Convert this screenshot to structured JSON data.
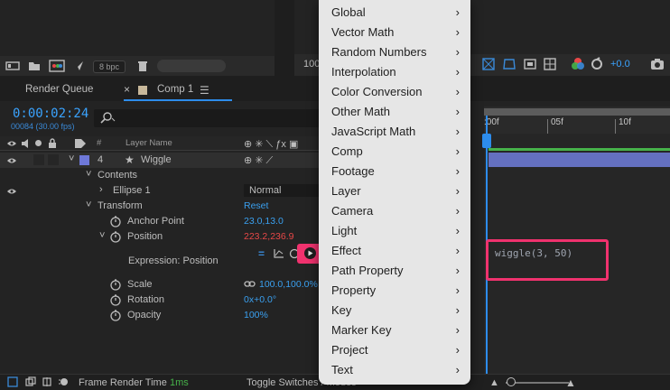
{
  "project_panel": {
    "bpc_label": "8 bpc"
  },
  "viewer_toolbar": {
    "zoom_value": "100",
    "exposure_value": "+0.0"
  },
  "tabs": [
    {
      "label": "Render Queue"
    },
    {
      "label": "Comp 1"
    }
  ],
  "timeline": {
    "current_time": "0:00:02:24",
    "frame_info": "00084 (30.00 fps)",
    "columns": {
      "number": "#",
      "layer_name": "Layer Name"
    },
    "ruler_labels": [
      ":00f",
      "05f",
      "10f"
    ],
    "rows": {
      "layer_number": "4",
      "layer_name": "Wiggle",
      "contents": "Contents",
      "ellipse": "Ellipse 1",
      "blend_mode": "Normal",
      "transform": "Transform",
      "reset": "Reset",
      "anchor_label": "Anchor Point",
      "anchor_value": "23.0,13.0",
      "position_label": "Position",
      "position_value": "223.2,236.9",
      "expression_label": "Expression: Position",
      "scale_label": "Scale",
      "scale_value": "100.0,100.0%",
      "rotation_label": "Rotation",
      "rotation_value": "0x+0.0°",
      "opacity_label": "Opacity",
      "opacity_value": "100%"
    },
    "expression_text": "wiggle(3, 50)"
  },
  "menu": {
    "items": [
      "Global",
      "Vector Math",
      "Random Numbers",
      "Interpolation",
      "Color Conversion",
      "Other Math",
      "JavaScript Math",
      "Comp",
      "Footage",
      "Layer",
      "Camera",
      "Light",
      "Effect",
      "Path Property",
      "Property",
      "Key",
      "Marker Key",
      "Project",
      "Text"
    ]
  },
  "footer": {
    "render_time_label": "Frame Render Time",
    "render_time_value": "1ms",
    "toggle_label": "Toggle Switches / Modes"
  },
  "colors": {
    "accent_blue": "#2d8ceb",
    "highlight_pink": "#f0326e",
    "layer_bar": "#6470c0"
  }
}
